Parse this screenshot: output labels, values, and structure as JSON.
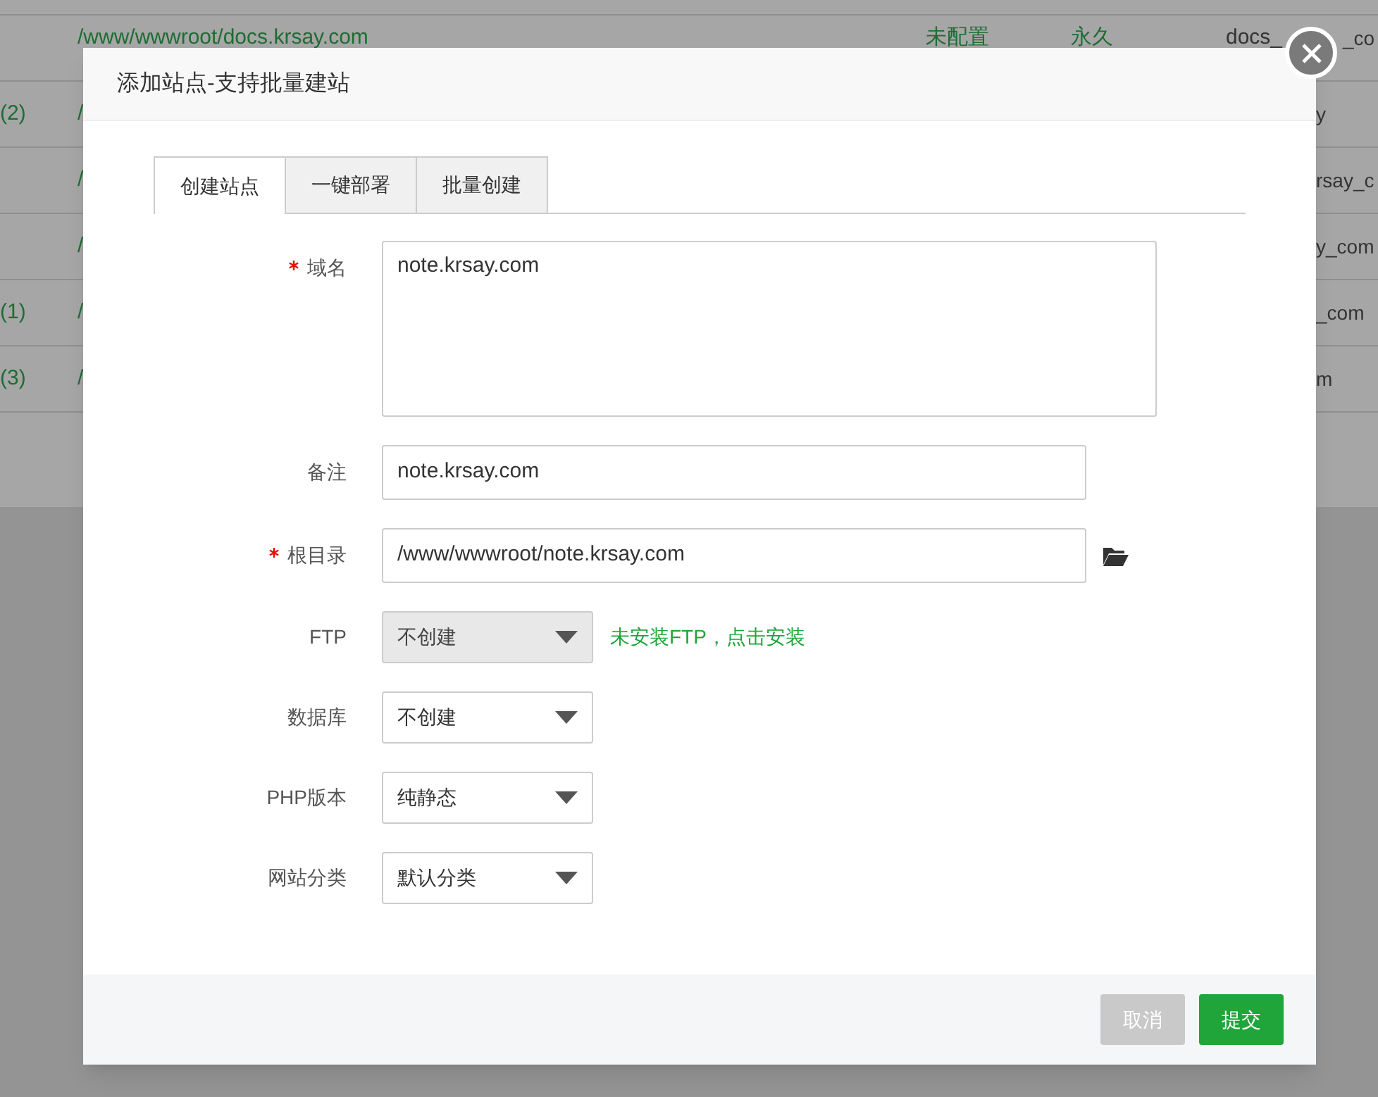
{
  "background_table": {
    "rows": [
      {
        "count": "",
        "path": "/www/wwwroot/docs.krsay.com",
        "status": "未配置",
        "expiry": "永久",
        "name": "docs_",
        "name_tail": "_co"
      },
      {
        "count": "(2)",
        "path": "/",
        "name_tail": "y"
      },
      {
        "count": "",
        "path": "/",
        "name_tail": "rsay_c"
      },
      {
        "count": "",
        "path": "/",
        "name_tail": "y_com"
      },
      {
        "count": "(1)",
        "path": "/",
        "name_tail": "_com"
      },
      {
        "count": "(3)",
        "path": "/",
        "name_tail": "m"
      }
    ]
  },
  "dialog": {
    "title": "添加站点-支持批量建站",
    "tabs": [
      {
        "label": "创建站点",
        "selected": true
      },
      {
        "label": "一键部署",
        "selected": false
      },
      {
        "label": "批量创建",
        "selected": false
      }
    ],
    "fields": [
      {
        "kind": "textarea",
        "label": "域名",
        "required": true,
        "value": "note.krsay.com"
      },
      {
        "kind": "input",
        "label": "备注",
        "required": false,
        "value": "note.krsay.com"
      },
      {
        "kind": "path",
        "label": "根目录",
        "required": true,
        "value": "/www/wwwroot/note.krsay.com"
      },
      {
        "kind": "select",
        "label": "FTP",
        "required": false,
        "value": "不创建",
        "disabled": true,
        "note": "未安装FTP，点击安装"
      },
      {
        "kind": "select",
        "label": "数据库",
        "required": false,
        "value": "不创建",
        "disabled": false
      },
      {
        "kind": "select",
        "label": "PHP版本",
        "required": false,
        "value": "纯静态",
        "disabled": false
      },
      {
        "kind": "select",
        "label": "网站分类",
        "required": false,
        "value": "默认分类",
        "disabled": false
      }
    ],
    "buttons": [
      {
        "label": "取消",
        "kind": "cancel"
      },
      {
        "label": "提交",
        "kind": "primary"
      }
    ]
  }
}
